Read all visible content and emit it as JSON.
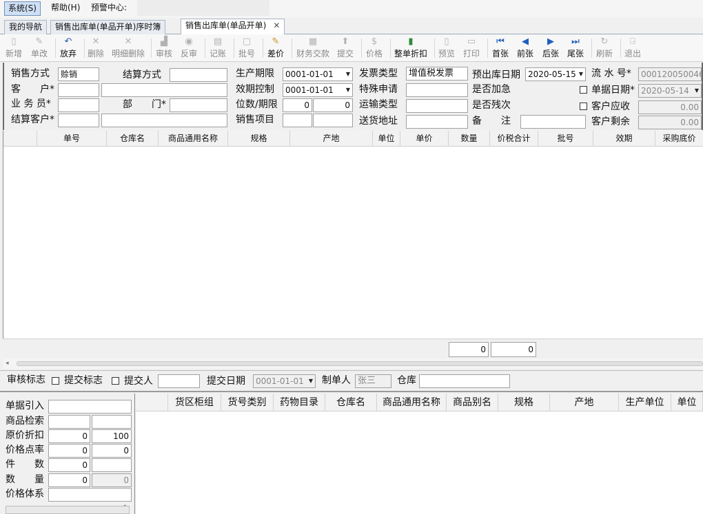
{
  "menu": {
    "system": "系统(S)",
    "help": "帮助(H)",
    "alert_label": "预警中心:"
  },
  "tabs": [
    {
      "label": "我的导航"
    },
    {
      "label": "销售出库单(单品开单)序时簿"
    },
    {
      "label": "销售出库单(单品开单)",
      "close": "✕"
    }
  ],
  "toolbar": {
    "new": "新增",
    "copy": "单改",
    "discard": "放弃",
    "delete": "删除",
    "delete_detail": "明细删除",
    "audit": "审核",
    "unaudit": "反审",
    "post": "记账",
    "batch": "批号",
    "price_diff": "差价",
    "finance": "财务交款",
    "submit": "提交",
    "price": "价格",
    "whole_discount": "整单折扣",
    "preview": "预览",
    "print": "打印",
    "first": "首张",
    "prev": "前张",
    "next": "后张",
    "last": "尾张",
    "refresh": "刷新",
    "exit": "退出"
  },
  "form": {
    "sale_mode_label": "销售方式",
    "sale_mode": "赊销",
    "settle_label": "结算方式",
    "settle": "",
    "customer_label": "客　　户*",
    "salesman_label": "业 务 员*",
    "dept_label": "部　　门*",
    "settle_customer_label": "结算客户*",
    "prod_limit_label": "生产期限",
    "prod_limit": "0001-01-01",
    "expiry_label": "效期控制",
    "expiry": "0001-01-01",
    "digits_label": "位数/期限",
    "digits_a": "0",
    "digits_b": "0",
    "sales_item_label": "销售项目",
    "invoice_type_label": "发票类型",
    "invoice_type": "增值税发票",
    "special_label": "特殊申请",
    "transport_label": "运输类型",
    "ship_addr_label": "送货地址",
    "expected_date_label": "预出库日期",
    "expected_date": "2020-05-15",
    "urgent_label": "是否加急",
    "residual_label": "是否残次",
    "remark_label": "备　　注",
    "serial_label": "流 水 号*",
    "serial": "000120050046",
    "doc_date_label": "单据日期*",
    "doc_date": "2020-05-14",
    "receivable_label": "客户应收",
    "receivable": "0.00",
    "remaining_label": "客户剩余",
    "remaining": "0.00"
  },
  "grid": {
    "headers": [
      "单号",
      "仓库名",
      "商品通用名称",
      "规格",
      "产地",
      "单位",
      "单价",
      "数量",
      "价税合计",
      "批号",
      "效期",
      "采购底价"
    ],
    "total_qty": "0",
    "total_amount": "0"
  },
  "status": {
    "audit_flag_label": "审核标志",
    "submit_flag_label": "提交标志",
    "submitter_label": "提交人",
    "submit_date_label": "提交日期",
    "submit_date": "0001-01-01",
    "maker_label": "制单人",
    "maker": "张三",
    "warehouse_label": "仓库"
  },
  "bottom_left": {
    "doc_import_label": "单据引入",
    "product_search_label": "商品检索",
    "discount_label": "原价折扣",
    "discount_a": "0",
    "discount_b": "100",
    "price_rate_label": "价格点率",
    "price_rate_a": "0",
    "price_rate_b": "0",
    "pieces_label": "件　　数",
    "pieces": "0",
    "quantity_label": "数　　量",
    "quantity_a": "0",
    "quantity_b": "0",
    "price_system_label": "价格体系"
  },
  "bottom_grid": {
    "headers": [
      "货区柜组",
      "货号类别",
      "药物目录",
      "仓库名",
      "商品通用名称",
      "商品别名",
      "规格",
      "产地",
      "生产单位",
      "单位"
    ]
  }
}
